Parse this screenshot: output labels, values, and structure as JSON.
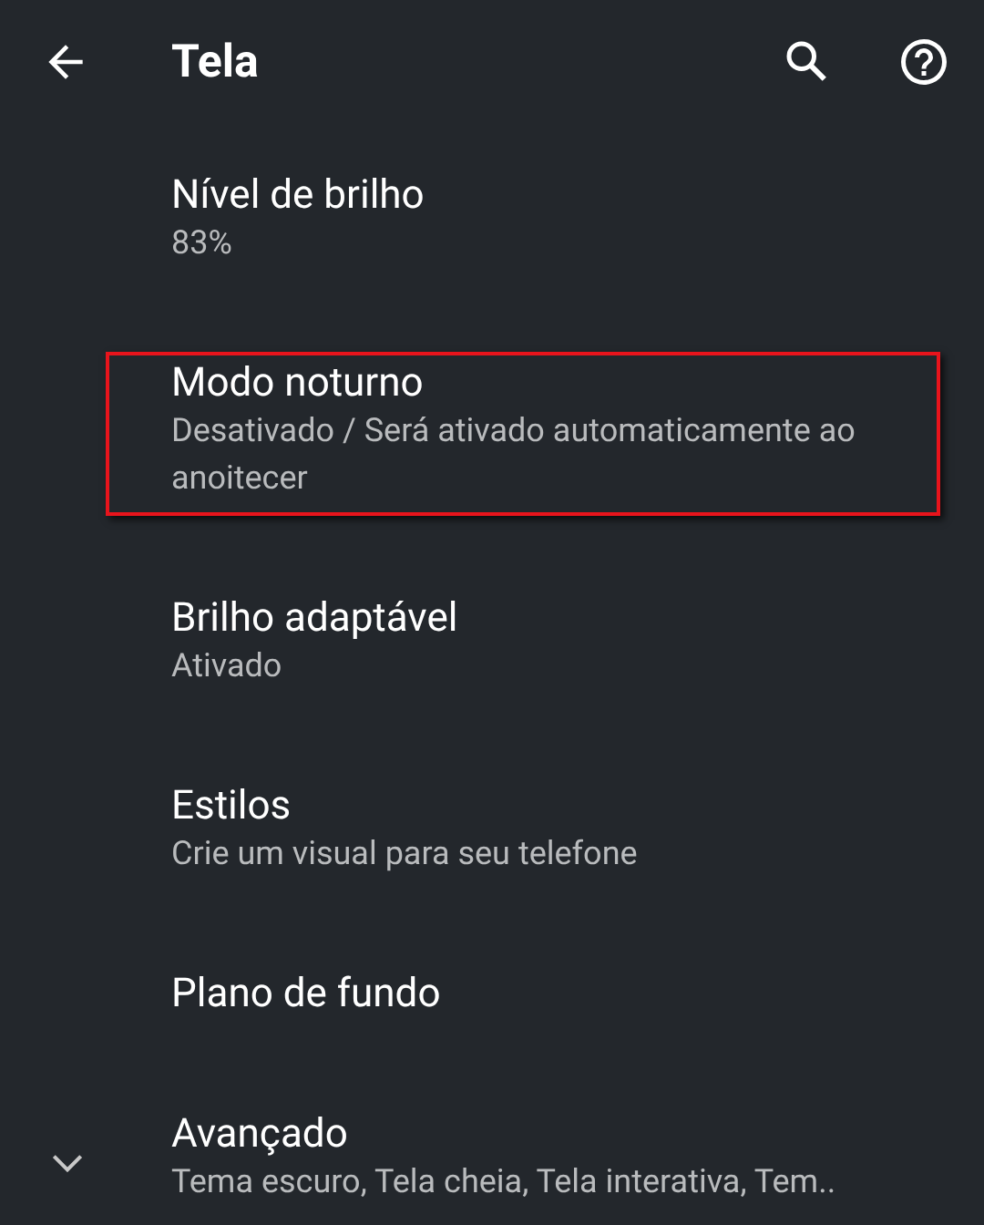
{
  "app_bar": {
    "title": "Tela"
  },
  "items": [
    {
      "title": "Nível de brilho",
      "summary": "83%",
      "highlighted": false,
      "kind": "plain"
    },
    {
      "title": "Modo noturno",
      "summary": "Desativado / Será ativado automaticamente ao anoitecer",
      "highlighted": true,
      "kind": "plain"
    },
    {
      "title": "Brilho adaptável",
      "summary": "Ativado",
      "highlighted": false,
      "kind": "plain"
    },
    {
      "title": "Estilos",
      "summary": "Crie um visual para seu telefone",
      "highlighted": false,
      "kind": "plain"
    },
    {
      "title": "Plano de fundo",
      "highlighted": false,
      "kind": "plain"
    },
    {
      "title": "Avançado",
      "summary": "Tema escuro, Tela cheia, Tela interativa, Tem..",
      "highlighted": false,
      "kind": "expandable"
    }
  ]
}
